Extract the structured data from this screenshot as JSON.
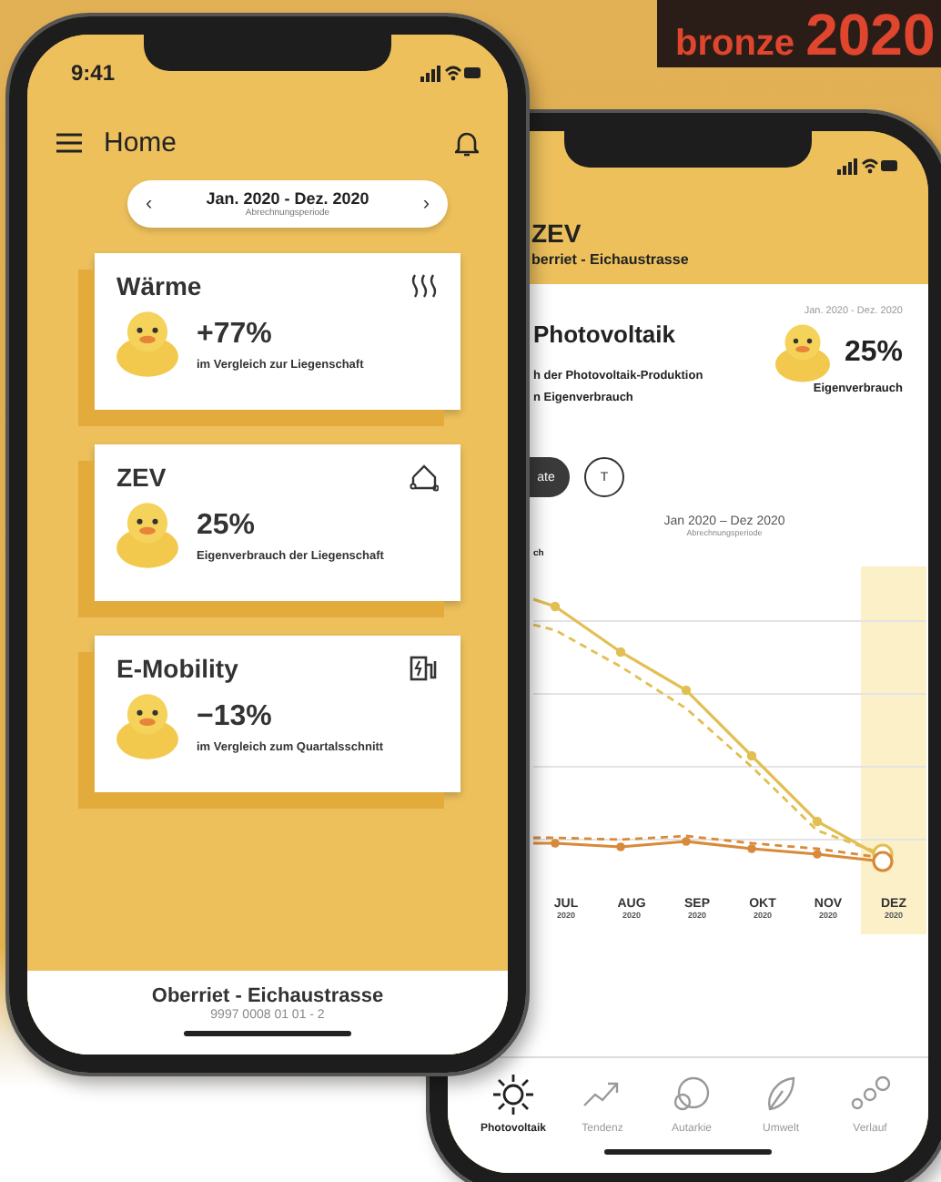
{
  "badge": {
    "label": "bronze",
    "year": "2020"
  },
  "phone_front": {
    "status_bar": {
      "time": "9:41"
    },
    "header": {
      "title": "Home"
    },
    "period": {
      "prev": "‹",
      "range": "Jan. 2020 - Dez. 2020",
      "caption": "Abrechnungsperiode",
      "next": "›"
    },
    "cards": [
      {
        "kind": "heat",
        "title": "Wärme",
        "value": "+77%",
        "caption": "im Vergleich zur Liegenschaft"
      },
      {
        "kind": "house",
        "title": "ZEV",
        "value": "25%",
        "caption": "Eigenverbrauch der Liegenschaft"
      },
      {
        "kind": "charger",
        "title": "E-Mobility",
        "value": "−13%",
        "caption": "im Vergleich zum Quartalsschnitt"
      }
    ],
    "footer": {
      "title": "Oberriet - Eichaustrasse",
      "subtitle": "9997 0008 01 01 - 2"
    }
  },
  "phone_back": {
    "header": {
      "title": "ZEV",
      "subtitle": "berriet - Eichaustrasse"
    },
    "summary": {
      "title": "Photovoltaik",
      "description_lines": [
        "h der Photovoltaik-Produktion",
        "n Eigenverbrauch"
      ],
      "period": "Jan. 2020 - Dez. 2020",
      "value": "25%",
      "caption": "Eigenverbrauch"
    },
    "filters": [
      {
        "label": "ate",
        "selected": true
      },
      {
        "label": "T",
        "selected": false
      }
    ],
    "chart": {
      "period": "Jan 2020 – Dez 2020",
      "caption": "Abrechnungsperiode",
      "axis_label": "ch",
      "months": [
        {
          "label": "JUL",
          "year": "2020",
          "selected": false
        },
        {
          "label": "AUG",
          "year": "2020",
          "selected": false
        },
        {
          "label": "SEP",
          "year": "2020",
          "selected": false
        },
        {
          "label": "OKT",
          "year": "2020",
          "selected": false
        },
        {
          "label": "NOV",
          "year": "2020",
          "selected": false
        },
        {
          "label": "DEZ",
          "year": "2020",
          "selected": true
        }
      ]
    },
    "tabs": [
      {
        "kind": "sun",
        "label": "Photovoltaik",
        "selected": true
      },
      {
        "kind": "trend",
        "label": "Tendenz",
        "selected": false
      },
      {
        "kind": "circles",
        "label": "Autarkie",
        "selected": false
      },
      {
        "kind": "leaf",
        "label": "Umwelt",
        "selected": false
      },
      {
        "kind": "dots",
        "label": "Verlauf",
        "selected": false
      }
    ]
  }
}
